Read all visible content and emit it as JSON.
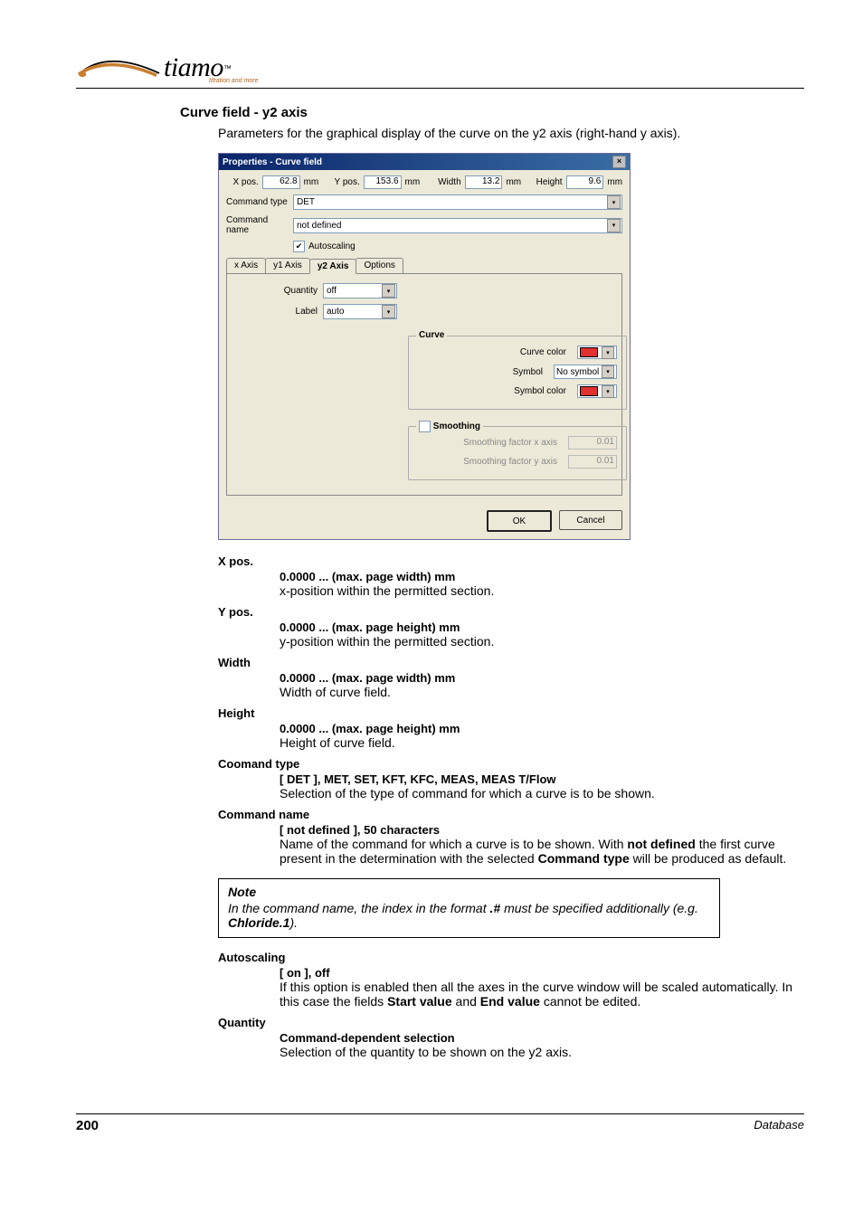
{
  "header": {
    "logo_text": "tiamo",
    "logo_tm": "™",
    "logo_sub": "titration and more"
  },
  "section": {
    "title": "Curve field - y2 axis",
    "para": "Parameters for the graphical display of the curve on the y2 axis (right-hand y axis)."
  },
  "dialog": {
    "title": "Properties - Curve field",
    "xpos_label": "X pos.",
    "xpos_value": "62.8",
    "xpos_unit": "mm",
    "ypos_label": "Y pos.",
    "ypos_value": "153.6",
    "ypos_unit": "mm",
    "width_label": "Width",
    "width_value": "13.2",
    "width_unit": "mm",
    "height_label": "Height",
    "height_value": "9.6",
    "height_unit": "mm",
    "cmdtype_label": "Command type",
    "cmdtype_value": "DET",
    "cmdname_label": "Command name",
    "cmdname_value": "not defined",
    "autoscaling_label": "Autoscaling",
    "tabs": {
      "x": "x Axis",
      "y1": "y1 Axis",
      "y2": "y2 Axis",
      "opt": "Options"
    },
    "quantity_label": "Quantity",
    "quantity_value": "off",
    "label_label": "Label",
    "label_value": "auto",
    "curve_group": "Curve",
    "curve_color_label": "Curve color",
    "curve_color": "#e03030",
    "symbol_label": "Symbol",
    "symbol_value": "No symbol",
    "symbol_color_label": "Symbol color",
    "symbol_color": "#e03030",
    "smoothing_group": "Smoothing",
    "smooth_x_label": "Smoothing factor x axis",
    "smooth_x_value": "0.01",
    "smooth_y_label": "Smoothing factor y axis",
    "smooth_y_value": "0.01",
    "ok": "OK",
    "cancel": "Cancel"
  },
  "defs": {
    "xpos": {
      "term": "X pos.",
      "range": "0.0000 ... (max. page width) mm",
      "desc": "x-position within the permitted section."
    },
    "ypos": {
      "term": "Y pos.",
      "range": "0.0000 ... (max. page height) mm",
      "desc": "y-position within the permitted section."
    },
    "width": {
      "term": "Width",
      "range": "0.0000 ... (max. page width) mm",
      "desc": "Width of curve field."
    },
    "height": {
      "term": "Height",
      "range": "0.0000 ... (max. page height) mm",
      "desc": "Height of curve field."
    },
    "cmdtype": {
      "term": "Coomand type",
      "range": "[ DET ], MET, SET, KFT, KFC, MEAS, MEAS T/Flow",
      "desc": "Selection of the type of command for which a curve is to be shown."
    },
    "cmdname": {
      "term": "Command name",
      "range": "[ not defined ], 50 characters",
      "desc_a": "Name of the command for which a curve is to be shown. With ",
      "desc_b": "not defined",
      "desc_c": " the first curve present in the determination with the selected ",
      "desc_d": "Command type",
      "desc_e": " will be produced as default."
    },
    "autoscaling": {
      "term": "Autoscaling",
      "range": "[ on ], off",
      "desc_a": "If this option is enabled then all the axes in the curve window will be scaled automatically. In this case the fields ",
      "desc_b": "Start value",
      "desc_c": " and ",
      "desc_d": "End value",
      "desc_e": " cannot be edited."
    },
    "quantity": {
      "term": "Quantity",
      "range": "Command-dependent selection",
      "desc": "Selection of the quantity to be shown on the y2 axis."
    }
  },
  "note": {
    "title": "Note",
    "body_a": "In the command name, the index in the format ",
    "body_b": ".#",
    "body_c": " must be specified additionally (e.g. ",
    "body_d": "Chloride.1",
    "body_e": ")."
  },
  "footer": {
    "page": "200",
    "section": "Database"
  }
}
